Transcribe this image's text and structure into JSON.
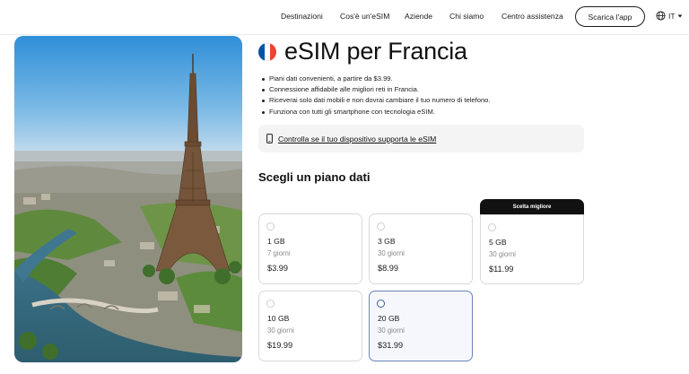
{
  "nav": {
    "items": [
      "Destinazioni",
      "Cos'è un'eSIM",
      "Aziende",
      "Chi siamo",
      "Centro assistenza"
    ],
    "download_label": "Scarica l'app",
    "language": "IT"
  },
  "hero": {
    "icon": "eiffel-tower-photo"
  },
  "product": {
    "title": "eSIM per Francia",
    "flag_colors": [
      "#0055A4",
      "#FFFFFF",
      "#EF4135"
    ],
    "bullets": [
      "Piani dati convenienti, a partire da $3.99.",
      "Connessione affidabile alle migliori reti in Francia.",
      "Riceverai solo dati mobili e non dovrai cambiare il tuo numero di telefono.",
      "Funziona con tutti gli smartphone con tecnologia eSIM."
    ],
    "check_link": "Controlla se il tuo dispositivo supporta le eSIM",
    "check_icon": "phone-icon"
  },
  "plans": {
    "section_title": "Scegli un piano dati",
    "best_label": "Scelta migliore",
    "items": [
      {
        "data": "1 GB",
        "days": "7 giorni",
        "price": "$3.99",
        "selected": false
      },
      {
        "data": "3 GB",
        "days": "30 giorni",
        "price": "$8.99",
        "selected": false
      },
      {
        "data": "5 GB",
        "days": "30 giorni",
        "price": "$11.99",
        "selected": false
      },
      {
        "data": "10 GB",
        "days": "30 giorni",
        "price": "$19.99",
        "selected": false
      },
      {
        "data": "20 GB",
        "days": "30 giorni",
        "price": "$31.99",
        "selected": true
      }
    ]
  },
  "colors": {
    "selected_border": "#6b84b8",
    "selected_radio": "#3a5aa0",
    "text": "#1b1b1b"
  }
}
